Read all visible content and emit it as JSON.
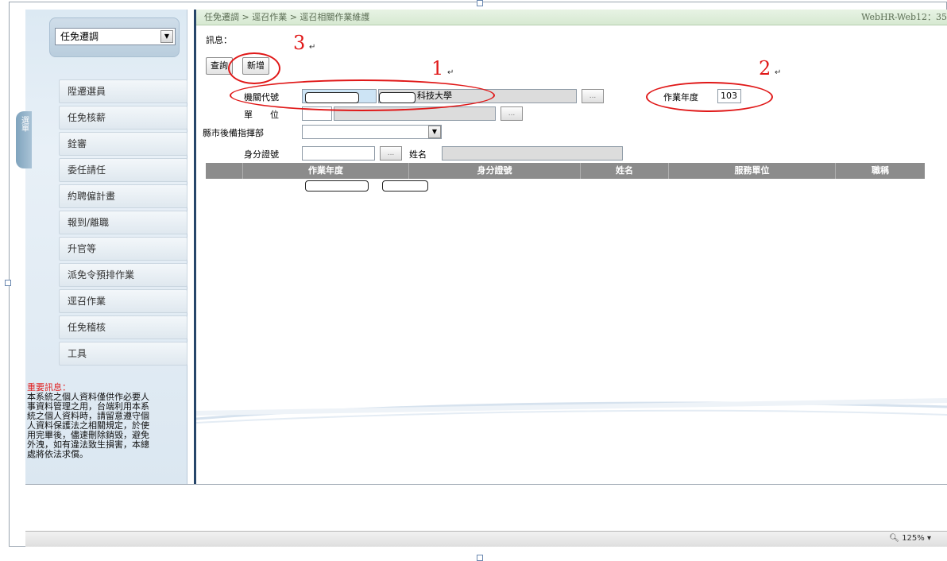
{
  "left": {
    "dropdown_value": "任免遷調",
    "side_tab": "選單",
    "menu": [
      {
        "label": "陞遷選員"
      },
      {
        "label": "任免核薪"
      },
      {
        "label": "銓審"
      },
      {
        "label": "委任請任"
      },
      {
        "label": "約聘僱計畫"
      },
      {
        "label": "報到/離職"
      },
      {
        "label": "升官等"
      },
      {
        "label": "派免令預排作業"
      },
      {
        "label": "逕召作業"
      },
      {
        "label": "任免稽核"
      },
      {
        "label": "工具"
      }
    ],
    "notice_heading": "重要訊息：",
    "notice_body": "本系統之個人資料僅供作必要人事資料管理之用，台端利用本系統之個人資料時，請留意遵守個人資料保護法之相關規定，於使用完畢後，儘速刪除銷毀，避免外洩，如有違法致生損害，本總處將依法求償。"
  },
  "main": {
    "breadcrumb": "任免遷調 > 逕召作業 > 逕召相關作業維護",
    "system_name": "WebHR-Web12：35",
    "message_label": "訊息：",
    "buttons": {
      "query": "查詢",
      "add": "新增"
    },
    "form": {
      "org_code_label": "機關代號",
      "org_name_suffix": "科技大學",
      "year_label": "作業年度",
      "year_value": "103",
      "unit_label": "單　　位",
      "county_label": "縣市後備指揮部",
      "id_label": "身分證號",
      "name_label": "姓名",
      "dots": "..."
    },
    "grid_columns": [
      "",
      "作業年度",
      "身分證號",
      "姓名",
      "服務單位",
      "職稱"
    ]
  },
  "annotations": [
    "1",
    "2",
    "3"
  ],
  "return_mark": "↵",
  "status": {
    "zoom": "125%"
  },
  "colors": {
    "highlight": "#e01818",
    "sidebar": "#dce9f3",
    "grid_header": "#8c8c8c",
    "breadcrumb": "#d7e9d2"
  }
}
